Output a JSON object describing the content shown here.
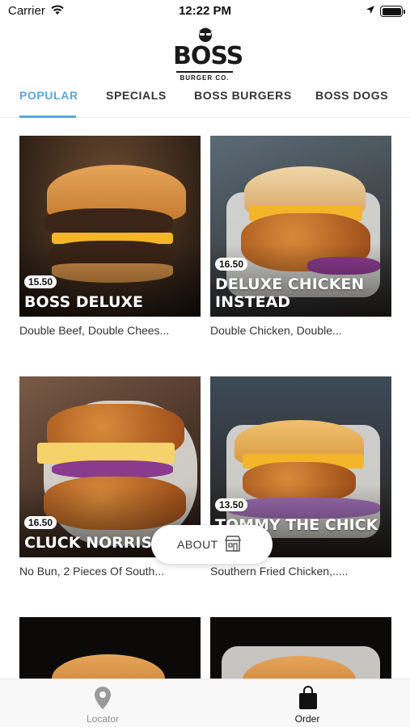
{
  "status_bar": {
    "carrier": "Carrier",
    "time": "12:22 PM"
  },
  "brand": {
    "name": "BOSS",
    "sub": "BURGER CO."
  },
  "tabs": [
    {
      "label": "POPULAR",
      "active": true
    },
    {
      "label": "SPECIALS",
      "active": false
    },
    {
      "label": "BOSS BURGERS",
      "active": false
    },
    {
      "label": "BOSS DOGS",
      "active": false
    }
  ],
  "menu_items": [
    {
      "title": "BOSS DELUXE",
      "price": "15.50",
      "description": "Double Beef, Double Chees..."
    },
    {
      "title": "DELUXE CHICKEN INSTEAD",
      "title_line1": "DELUXE CHICKEN",
      "title_line2": "INSTEAD",
      "price": "16.50",
      "description": "Double Chicken, Double..."
    },
    {
      "title": "CLUCK NORRIS",
      "price": "16.50",
      "description": "No Bun, 2 Pieces Of South..."
    },
    {
      "title": "TOMMY THE CHICK",
      "price": "13.50",
      "description": "Southern Fried Chicken,....."
    }
  ],
  "about_button": {
    "label": "ABOUT"
  },
  "bottom_nav": [
    {
      "label": "Locator",
      "active": false
    },
    {
      "label": "Order",
      "active": true
    }
  ],
  "colors": {
    "accent": "#5aa6d6",
    "text": "#333333",
    "inactive": "#8e8e8e",
    "active": "#111111"
  }
}
